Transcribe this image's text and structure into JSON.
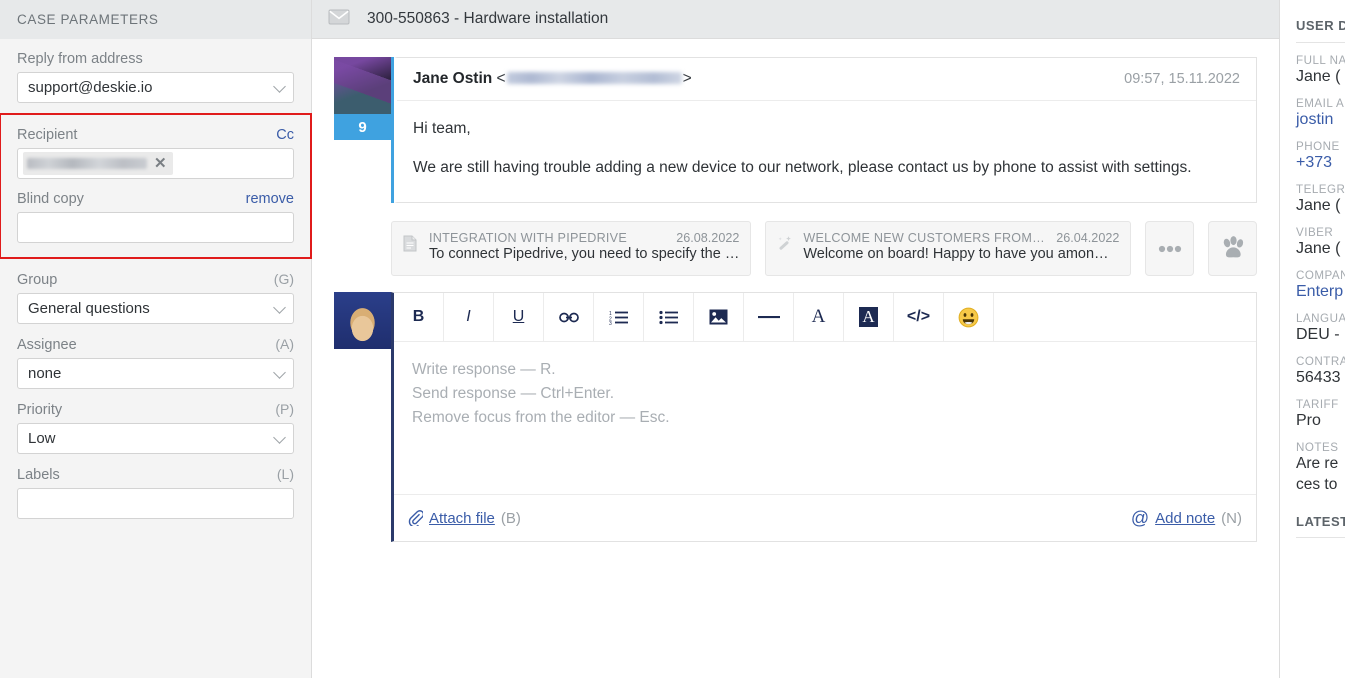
{
  "sidebar": {
    "header": "CASE PARAMETERS",
    "reply_from": {
      "label": "Reply from address",
      "value": "support@deskie.io"
    },
    "recipient": {
      "label": "Recipient",
      "cc_label": "Cc",
      "chip_value": ""
    },
    "blind_copy": {
      "label": "Blind copy",
      "remove_label": "remove",
      "value": ""
    },
    "group": {
      "label": "Group",
      "hint": "(G)",
      "value": "General questions"
    },
    "assignee": {
      "label": "Assignee",
      "hint": "(A)",
      "value": "none"
    },
    "priority": {
      "label": "Priority",
      "hint": "(P)",
      "value": "Low"
    },
    "labels": {
      "label": "Labels",
      "hint": "(L)",
      "value": ""
    }
  },
  "topbar": {
    "title": "300-550863 - Hardware installation",
    "icon": "envelope-icon"
  },
  "message": {
    "author": "Jane Ostin",
    "email_redacted": true,
    "timestamp": "09:57, 15.11.2022",
    "badge_count": "9",
    "body_paragraphs": [
      "Hi team,",
      "We are still having trouble adding a new device to our network, please contact us by phone to assist with settings."
    ]
  },
  "suggestion_cards": [
    {
      "icon": "document-icon",
      "title": "INTEGRATION WITH PIPEDRIVE",
      "date": "26.08.2022",
      "snippet": "To connect Pipedrive, you need to specify the …"
    },
    {
      "icon": "magic-wand-icon",
      "title": "WELCOME NEW CUSTOMERS FROM O…",
      "date": "26.04.2022",
      "snippet": "Welcome on board! Happy to have you amon…"
    }
  ],
  "card_buttons": [
    {
      "name": "more-options-button",
      "glyph": "•••"
    },
    {
      "name": "paw-button",
      "glyph": "paw-icon"
    }
  ],
  "editor": {
    "toolbar": [
      {
        "name": "bold-icon",
        "label": "B"
      },
      {
        "name": "italic-icon",
        "label": "I"
      },
      {
        "name": "underline-icon",
        "label": "U"
      },
      {
        "name": "link-icon",
        "label": "link"
      },
      {
        "name": "ordered-list-icon",
        "label": "ol"
      },
      {
        "name": "unordered-list-icon",
        "label": "ul"
      },
      {
        "name": "image-icon",
        "label": "img"
      },
      {
        "name": "horizontal-rule-icon",
        "label": "hr"
      },
      {
        "name": "text-color-icon",
        "label": "A"
      },
      {
        "name": "highlight-color-icon",
        "label": "A"
      },
      {
        "name": "code-icon",
        "label": "</>"
      },
      {
        "name": "emoji-icon",
        "label": "emoji"
      }
    ],
    "placeholder_lines": [
      "Write response — R.",
      "Send response — Ctrl+Enter.",
      "Remove focus from the editor — Esc."
    ],
    "attach_label": "Attach file",
    "attach_key": "(B)",
    "note_label": "Add note",
    "note_key": "(N)"
  },
  "user_details": {
    "title": "USER D",
    "fields": [
      {
        "label": "FULL NA",
        "value": "Jane (",
        "link": false
      },
      {
        "label": "EMAIL A",
        "value": "jostin",
        "link": true
      },
      {
        "label": "PHONE",
        "value": "+373",
        "link": true
      },
      {
        "label": "TELEGR",
        "value": "Jane (",
        "link": false
      },
      {
        "label": "VIBER",
        "value": "Jane (",
        "link": false
      },
      {
        "label": "COMPAN",
        "value": "Enterp",
        "link": true
      },
      {
        "label": "LANGUA",
        "value": "DEU -",
        "link": false
      },
      {
        "label": "CONTRA",
        "value": "56433",
        "link": false
      },
      {
        "label": "TARIFF",
        "value": "Pro",
        "link": false
      }
    ],
    "notes_label": "NOTES",
    "notes_lines": [
      "Are re",
      "ces to"
    ],
    "footer_title": "LATEST"
  },
  "colors": {
    "highlight_border": "#e01b1b",
    "accent_blue": "#3fa2e0",
    "link_blue": "#3a5ca8",
    "header_gray": "#e7e9ea",
    "sidebar_gray": "#f4f4f4"
  }
}
